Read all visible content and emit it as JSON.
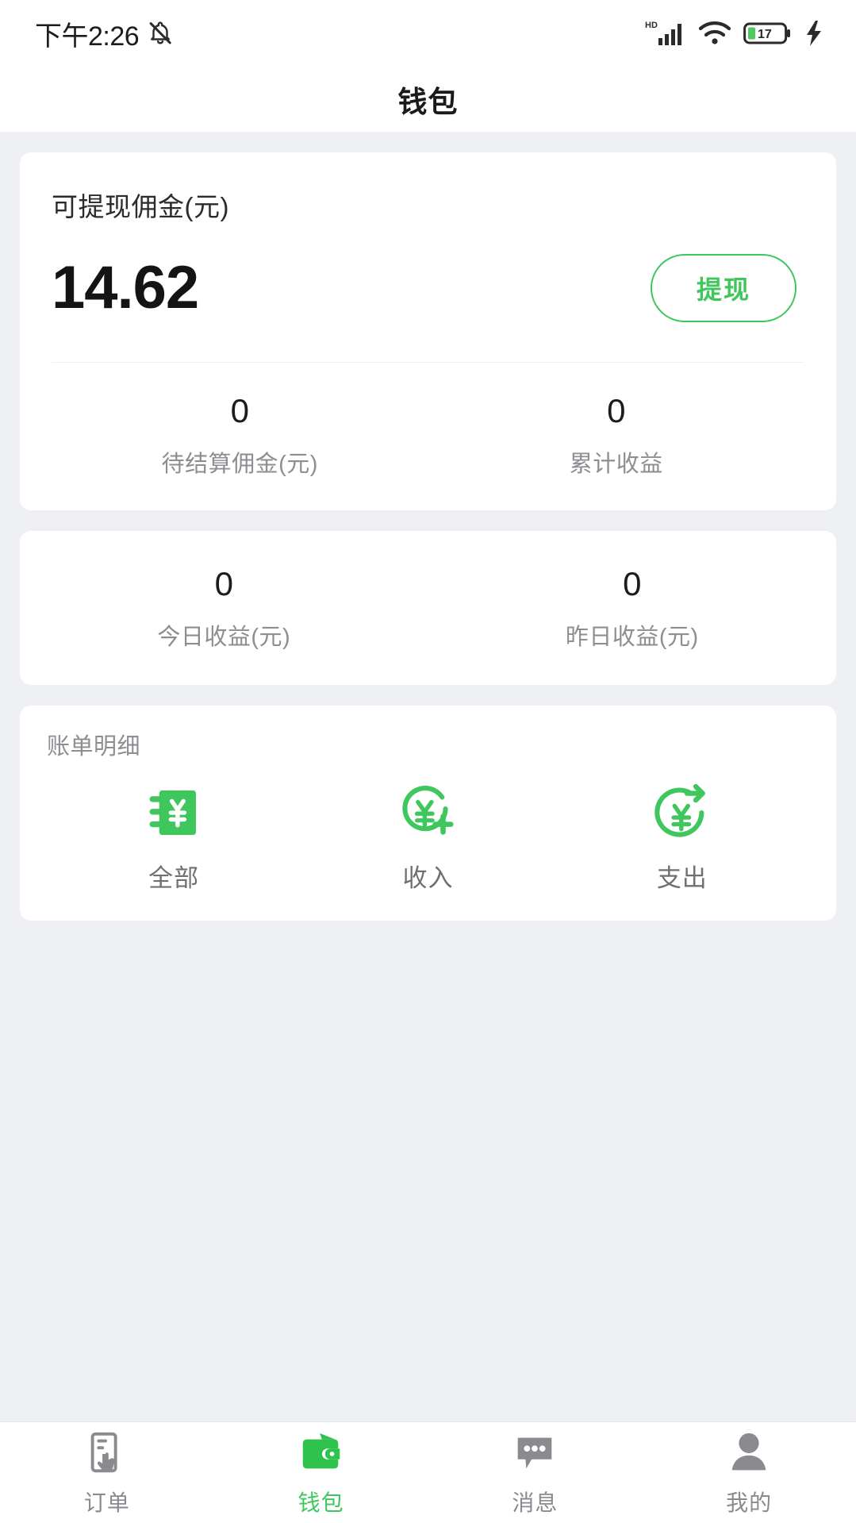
{
  "status_bar": {
    "time": "下午2:26",
    "mute_icon": "bell-muted-icon",
    "hd_label": "HD",
    "signal_icon": "signal-bars-icon",
    "wifi_icon": "wifi-icon",
    "battery_level": "17",
    "charging_icon": "charging-bolt-icon"
  },
  "header": {
    "title": "钱包"
  },
  "balance_card": {
    "label": "可提现佣金(元)",
    "amount": "14.62",
    "withdraw_label": "提现",
    "stats": [
      {
        "value": "0",
        "label": "待结算佣金(元)"
      },
      {
        "value": "0",
        "label": "累计收益"
      }
    ]
  },
  "earnings_card": {
    "stats": [
      {
        "value": "0",
        "label": "今日收益(元)"
      },
      {
        "value": "0",
        "label": "昨日收益(元)"
      }
    ]
  },
  "bill_card": {
    "title": "账单明细",
    "actions": [
      {
        "label": "全部",
        "icon": "ledger-yuan-icon"
      },
      {
        "label": "收入",
        "icon": "yuan-circle-plus-icon"
      },
      {
        "label": "支出",
        "icon": "yuan-circle-arrow-out-icon"
      }
    ]
  },
  "bottom_nav": {
    "items": [
      {
        "label": "订单",
        "icon": "phone-tap-icon",
        "active": false
      },
      {
        "label": "钱包",
        "icon": "wallet-icon",
        "active": true
      },
      {
        "label": "消息",
        "icon": "chat-bubble-icon",
        "active": false
      },
      {
        "label": "我的",
        "icon": "person-icon",
        "active": false
      }
    ]
  },
  "colors": {
    "accent_green": "#3fc75e",
    "page_background": "#eef0f3",
    "card_background": "#ffffff",
    "muted_text": "#8d8d92"
  }
}
